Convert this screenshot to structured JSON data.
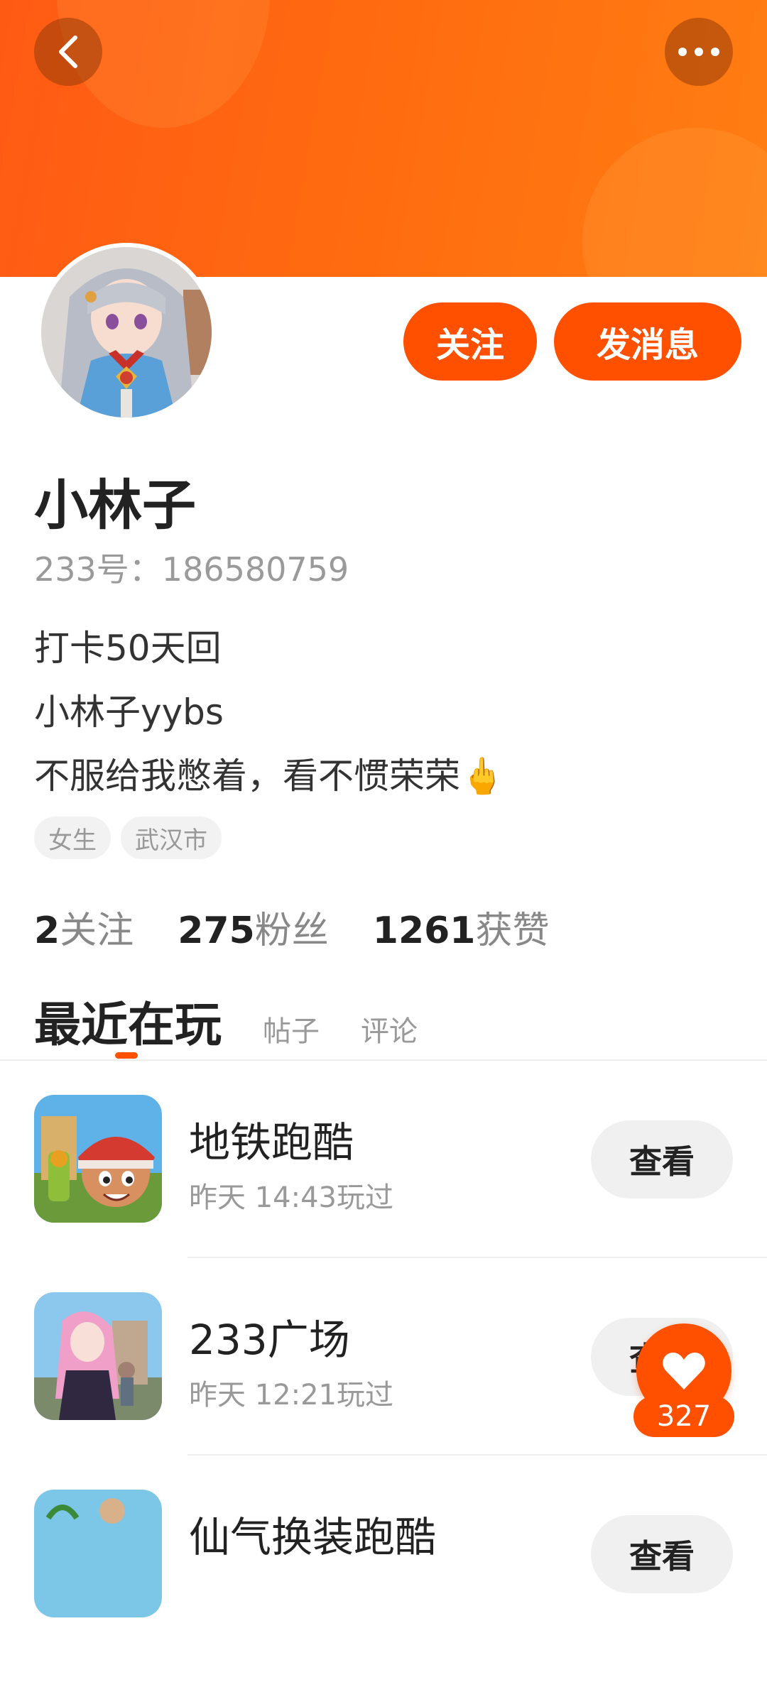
{
  "header": {
    "back_icon": "chevron-left-icon",
    "more_icon": "more-dots-icon",
    "accent": "#ff5000"
  },
  "profile": {
    "avatar": "anime-girl-avatar",
    "name": "小林子",
    "uid": "233号：186580759",
    "bio": [
      "打卡50天回",
      "小林子yybs",
      "不服给我憋着，看不惯荣荣🖕"
    ],
    "tags": [
      "女生",
      "武汉市"
    ],
    "follow_label": "关注",
    "message_label": "发消息"
  },
  "stats": [
    {
      "num": "2",
      "label": "关注"
    },
    {
      "num": "275",
      "label": "粉丝"
    },
    {
      "num": "1261",
      "label": "获赞"
    }
  ],
  "tabs": {
    "active": "最近在玩",
    "others": [
      "帖子",
      "评论"
    ]
  },
  "games": [
    {
      "name": "地铁跑酷",
      "time": "昨天 14:43玩过",
      "button": "查看"
    },
    {
      "name": "233广场",
      "time": "昨天 12:21玩过",
      "button": "查看"
    },
    {
      "name": "仙气换装跑酷",
      "time": "",
      "button": "查看"
    }
  ],
  "like": {
    "icon": "heart-icon",
    "count": "327"
  }
}
